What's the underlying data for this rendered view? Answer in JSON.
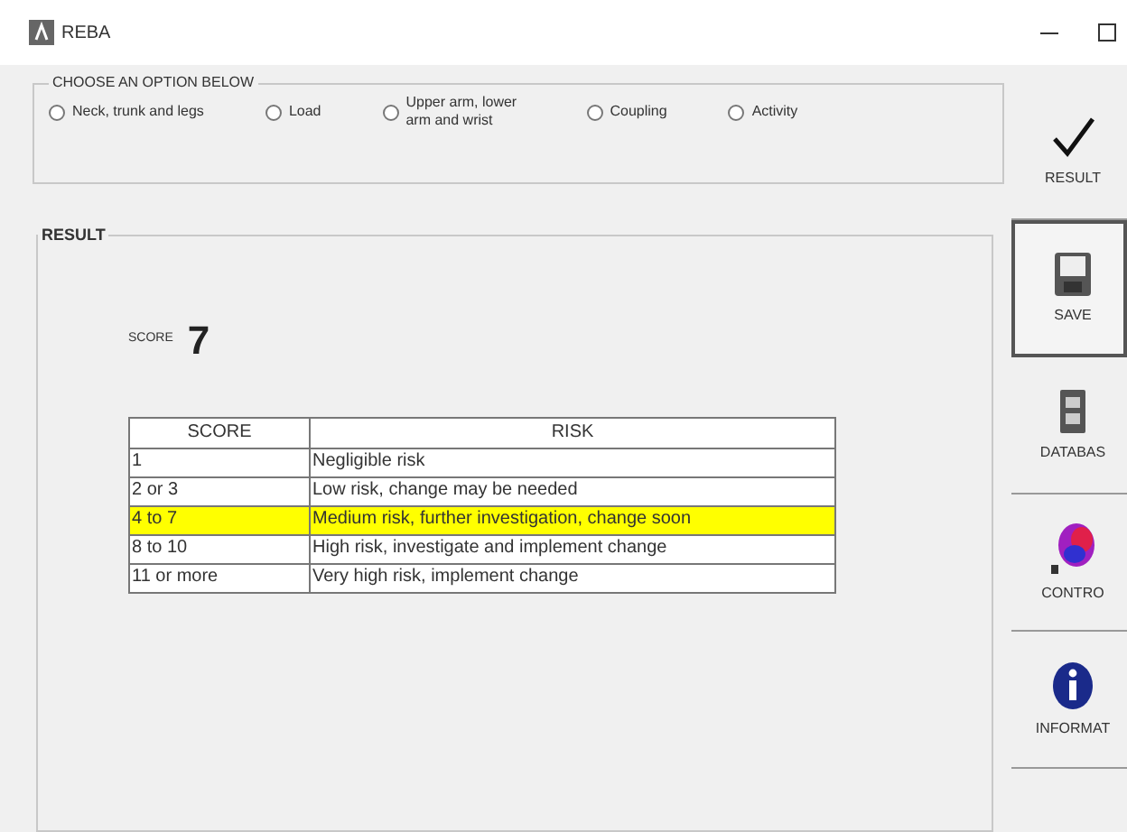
{
  "window": {
    "title": "REBA"
  },
  "options": {
    "title": "CHOOSE AN OPTION BELOW",
    "items": [
      {
        "label": "Neck, trunk and legs",
        "selected": false
      },
      {
        "label": "Load",
        "selected": false
      },
      {
        "label": "Upper arm, lower arm and wrist",
        "selected": false
      },
      {
        "label": "Coupling",
        "selected": false
      },
      {
        "label": "Activity",
        "selected": false
      }
    ]
  },
  "result": {
    "title": "RESULT",
    "score_label": "SCORE",
    "score": "7",
    "table": {
      "columns": [
        "SCORE",
        "RISK"
      ],
      "rows": [
        {
          "cells": [
            "1",
            "Negligible risk"
          ],
          "selected": false
        },
        {
          "cells": [
            "2 or 3",
            "Low risk, change may be needed"
          ],
          "selected": false
        },
        {
          "cells": [
            "4 to 7",
            "Medium risk, further investigation, change soon"
          ],
          "selected": true
        },
        {
          "cells": [
            "8 to 10",
            "High risk, investigate and implement change"
          ],
          "selected": false
        },
        {
          "cells": [
            "11 or more",
            "Very high risk, implement change"
          ],
          "selected": false
        }
      ]
    }
  },
  "side_buttons": [
    {
      "kind": "check",
      "label": "RESULT",
      "selected": false
    },
    {
      "kind": "save",
      "label": "SAVE",
      "selected": true
    },
    {
      "kind": "database",
      "label": "DATABAS",
      "selected": false
    },
    {
      "kind": "control",
      "label": "CONTRO",
      "selected": false
    },
    {
      "kind": "info",
      "label": "INFORMAT",
      "selected": false
    }
  ]
}
